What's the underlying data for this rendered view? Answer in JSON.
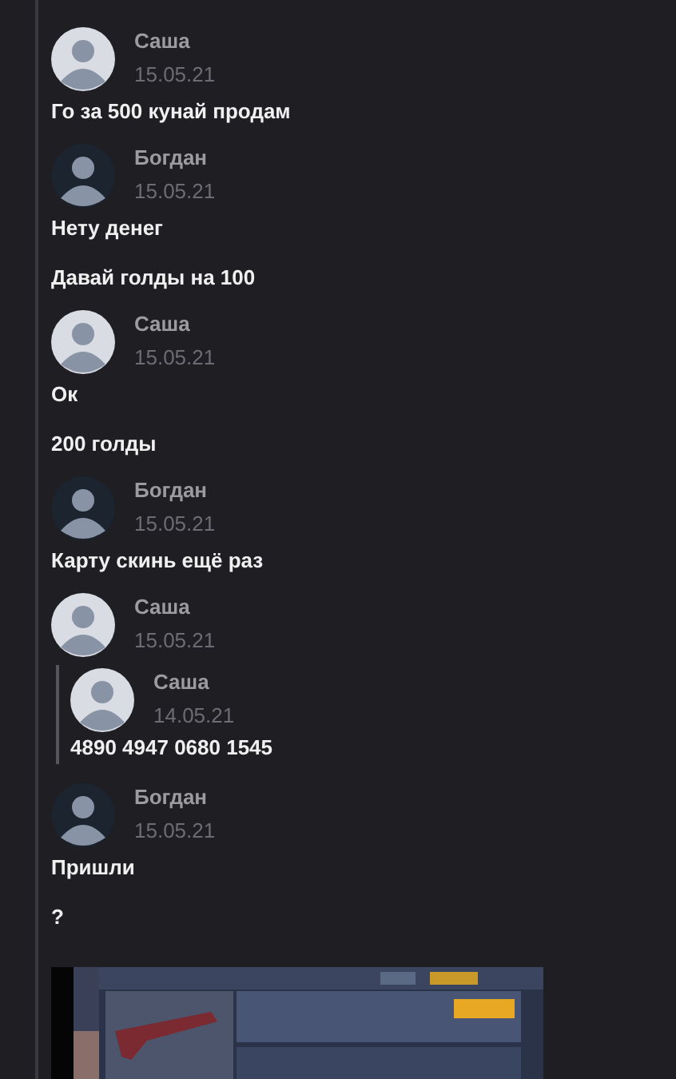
{
  "messages": [
    {
      "author": "Саша",
      "color": "#d9dde3",
      "date": "15.05.21",
      "items": [
        {
          "kind": "text",
          "text": "Го за 500 кунай продам"
        }
      ]
    },
    {
      "author": "Богдан",
      "color": "#1c2430",
      "date": "15.05.21",
      "items": [
        {
          "kind": "text",
          "text": "Нету денег"
        },
        {
          "kind": "text",
          "text": "Давай голды на 100"
        }
      ]
    },
    {
      "author": "Саша",
      "color": "#d9dde3",
      "date": "15.05.21",
      "items": [
        {
          "kind": "text",
          "text": "Ок"
        },
        {
          "kind": "text",
          "text": "200 голды"
        }
      ]
    },
    {
      "author": "Богдан",
      "color": "#1c2430",
      "date": "15.05.21",
      "items": [
        {
          "kind": "text",
          "text": "Карту скинь ещё раз"
        }
      ]
    },
    {
      "author": "Саша",
      "color": "#d9dde3",
      "date": "15.05.21",
      "items": [
        {
          "kind": "quote",
          "author": "Саша",
          "color": "#d9dde3",
          "date": "14.05.21",
          "text": "4890 4947 0680 1545"
        }
      ]
    },
    {
      "author": "Богдан",
      "color": "#1c2430",
      "date": "15.05.21",
      "items": [
        {
          "kind": "text",
          "text": "Пришли"
        },
        {
          "kind": "text",
          "text": "?"
        },
        {
          "kind": "picture"
        }
      ]
    }
  ]
}
